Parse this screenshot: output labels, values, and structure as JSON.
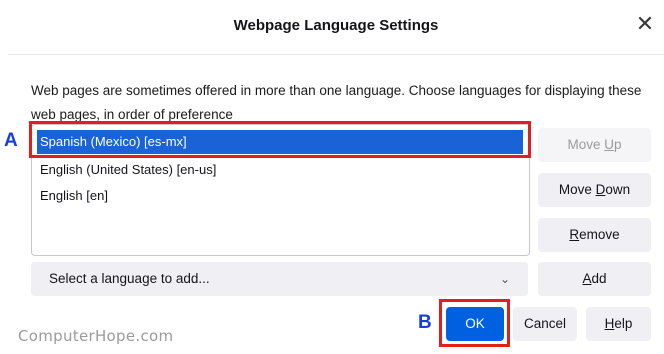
{
  "dialog": {
    "title": "Webpage Language Settings",
    "close_glyph": "✕",
    "description": "Web pages are sometimes offered in more than one language. Choose languages for displaying these web pages, in order of preference"
  },
  "languages": [
    {
      "label": "Spanish (Mexico) [es-mx]",
      "selected": true
    },
    {
      "label": "English (United States) [en-us]",
      "selected": false
    },
    {
      "label": "English [en]",
      "selected": false
    }
  ],
  "buttons": {
    "move_up": {
      "pre": "Move ",
      "key": "U",
      "post": "p",
      "disabled": true
    },
    "move_down": {
      "pre": "Move ",
      "key": "D",
      "post": "own"
    },
    "remove": {
      "pre": "",
      "key": "R",
      "post": "emove"
    },
    "add": {
      "pre": "",
      "key": "A",
      "post": "dd"
    },
    "ok": "OK",
    "cancel": "Cancel",
    "help": {
      "pre": "",
      "key": "H",
      "post": "elp"
    }
  },
  "add_select": {
    "value": "Select a language to add...",
    "chevron_glyph": "⌄"
  },
  "annotations": {
    "a": "A",
    "b": "B",
    "highlight_color": "#e0201b",
    "letter_color": "#1a3fd8"
  },
  "watermark": "ComputerHope.com",
  "colors": {
    "accent": "#0061e0",
    "selection": "#1963d6"
  }
}
